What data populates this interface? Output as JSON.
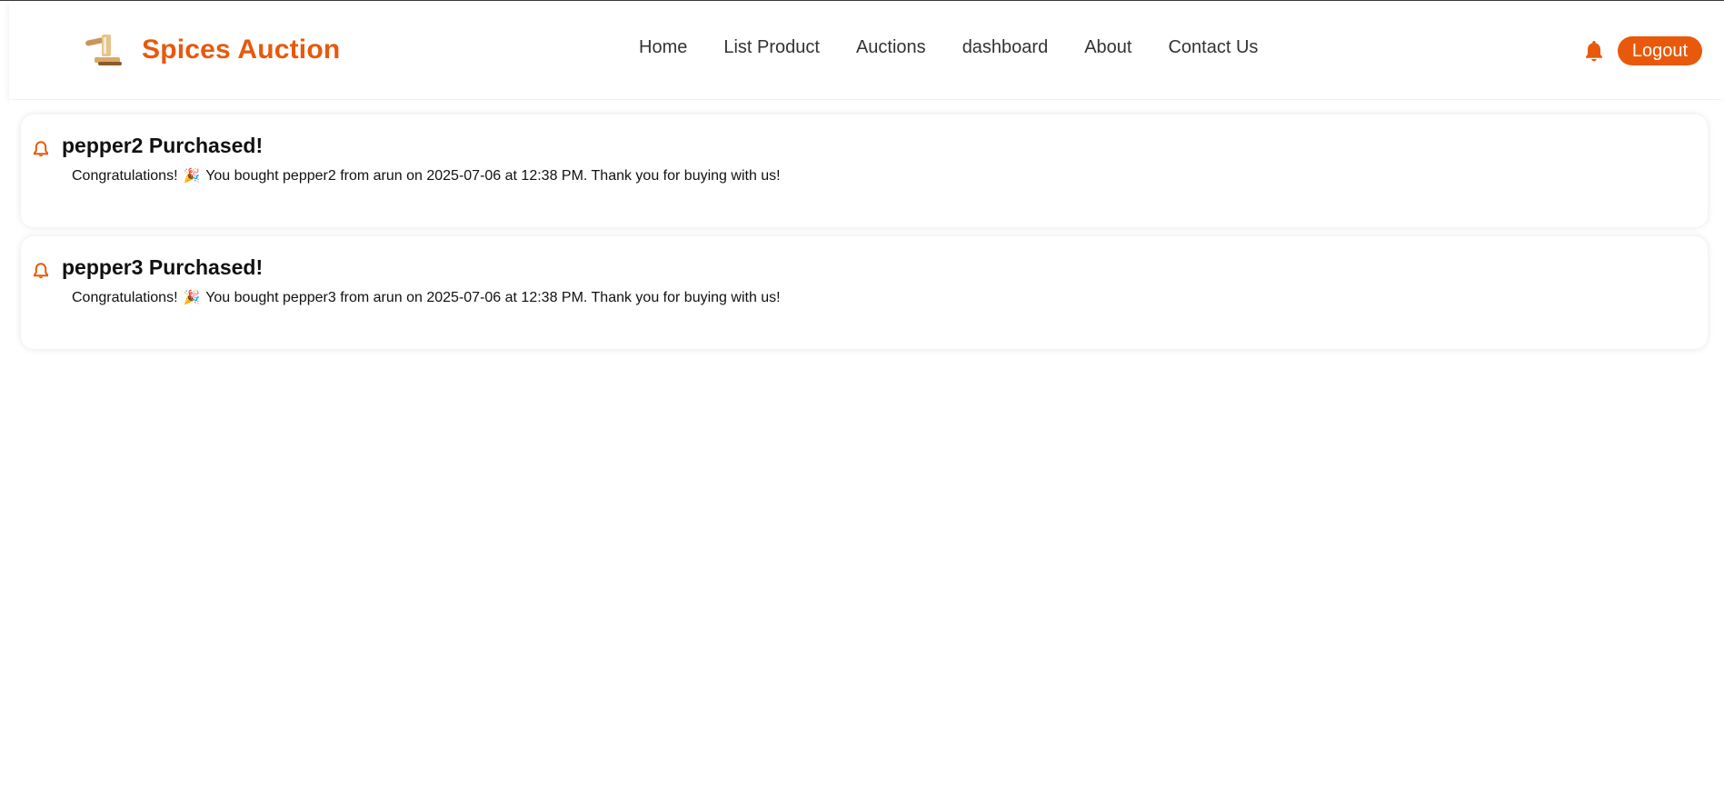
{
  "brand": {
    "name": "Spices Auction",
    "logo_icon": "gavel-icon",
    "accent_color": "#e8590c"
  },
  "nav": {
    "links": [
      "Home",
      "List Product",
      "Auctions",
      "dashboard",
      "About",
      "Contact Us"
    ]
  },
  "header_actions": {
    "bell_icon": "bell-icon",
    "logout_label": "Logout"
  },
  "notifications": [
    {
      "icon": "bell-outline-icon",
      "title": "pepper2 Purchased!",
      "message_prefix": "Congratulations!",
      "message_emoji": "🎉",
      "message_rest": "You bought pepper2 from arun on 2025-07-06 at 12:38 PM. Thank you for buying with us!"
    },
    {
      "icon": "bell-outline-icon",
      "title": "pepper3 Purchased!",
      "message_prefix": "Congratulations!",
      "message_emoji": "🎉",
      "message_rest": "You bought pepper3 from arun on 2025-07-06 at 12:38 PM. Thank you for buying with us!"
    }
  ]
}
